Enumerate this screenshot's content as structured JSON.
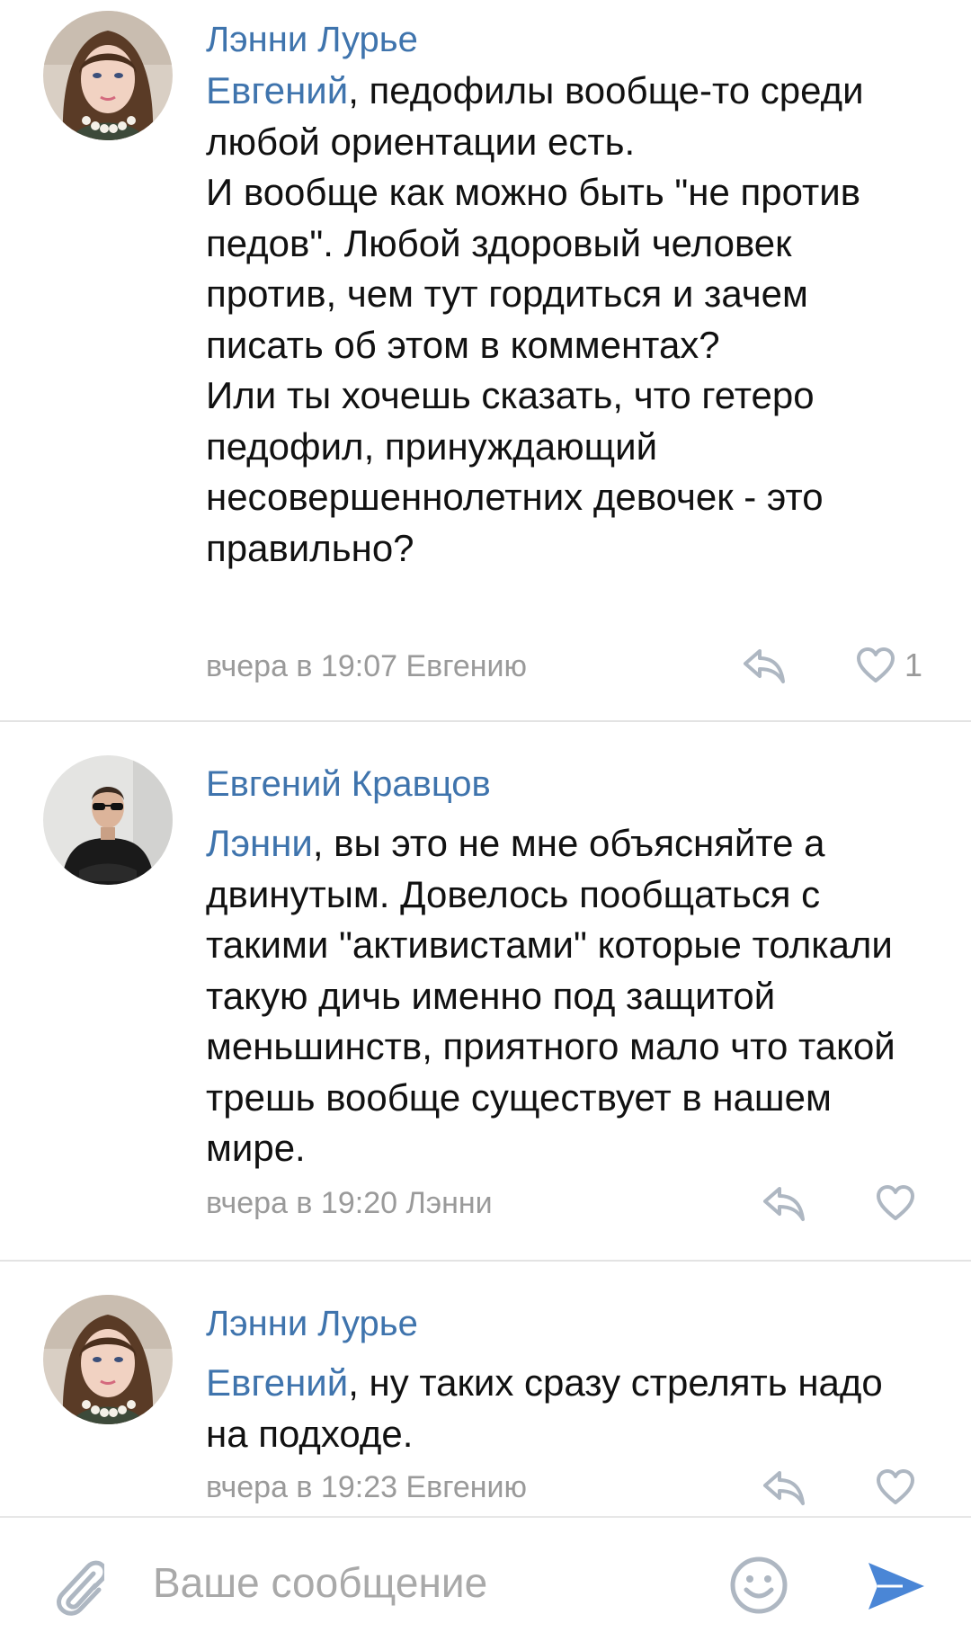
{
  "comments": [
    {
      "author": "Лэнни Лурье",
      "mention": "Евгений",
      "text": ", педофилы вообще-то среди любой ориентации есть.\nИ вообще как можно быть \"не против педов\". Любой здоровый человек против, чем тут гордиться и зачем писать об этом в комментах?\n Или ты хочешь сказать, что гетеро педофил, принуждающий несовершеннолетних девочек - это правильно?",
      "meta": "вчера в 19:07 Евгению",
      "likes": "1",
      "avatar_icon": "woman-portrait-avatar"
    },
    {
      "author": "Евгений Кравцов",
      "mention": "Лэнни",
      "text": ", вы это не мне объясняйте а двинутым. Довелось пообщаться с такими \"активистами\" которые толкали такую дичь именно под защитой меньшинств, приятного мало что такой трешь вообще существует в нашем мире.",
      "meta": "вчера в 19:20 Лэнни",
      "likes": "",
      "avatar_icon": "man-in-sunglasses-avatar"
    },
    {
      "author": "Лэнни Лурье",
      "mention": "Евгений",
      "text": ", ну таких сразу стрелять надо на подходе.",
      "meta": "вчера в 19:23 Евгению",
      "likes": "",
      "avatar_icon": "woman-portrait-avatar"
    }
  ],
  "composer": {
    "placeholder": "Ваше сообщение",
    "attach_icon": "paperclip-icon",
    "emoji_icon": "smiley-icon",
    "send_icon": "send-arrow-icon"
  },
  "colors": {
    "accent": "#3f74ad",
    "meta": "#9a9a9a",
    "icon": "#aeb7c2",
    "send": "#4a86d6"
  }
}
